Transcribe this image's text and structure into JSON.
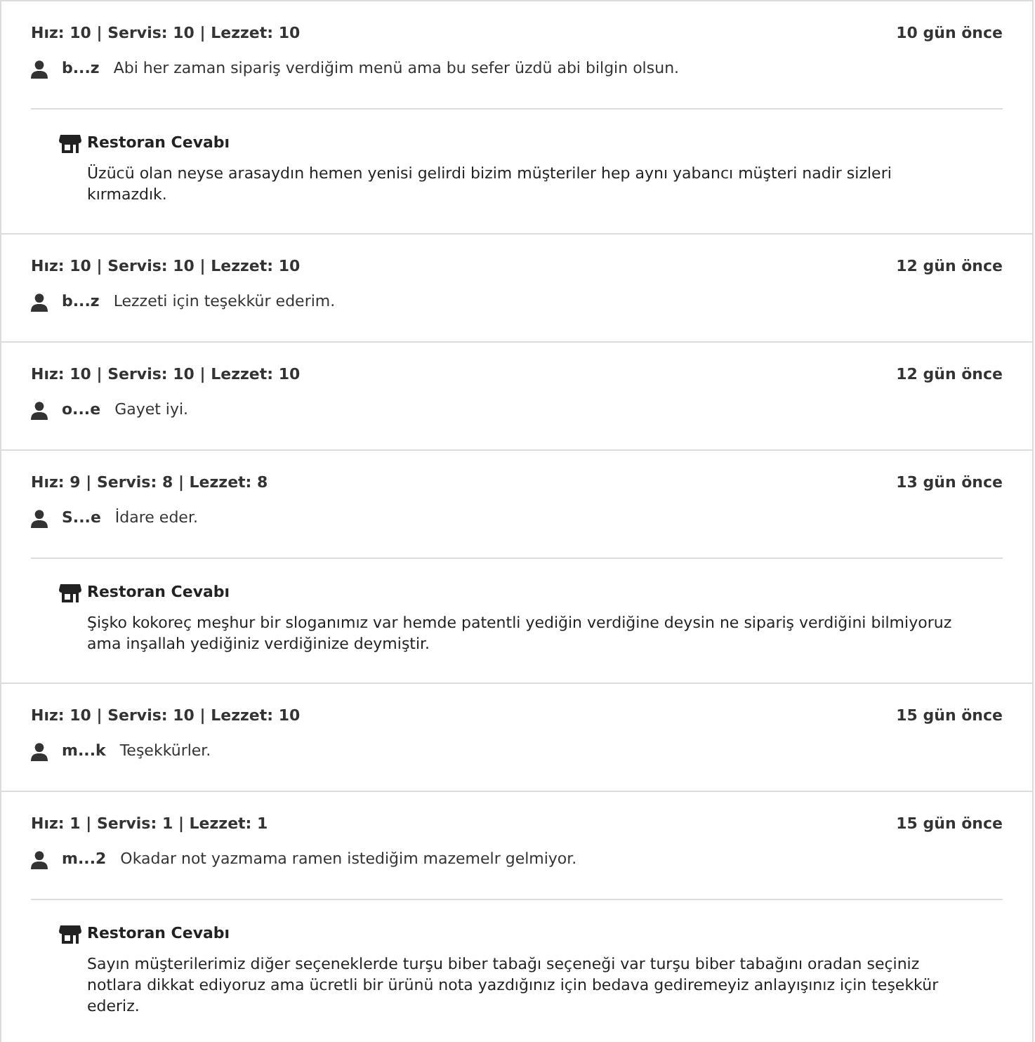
{
  "reviews": [
    {
      "ratings": "Hız: 10 | Servis: 10 | Lezzet: 10",
      "time": "10 gün önce",
      "user": "b...z",
      "comment": "Abi her zaman sipariş verdiğim menü ama bu sefer üzdü abi bilgin olsun.",
      "reply": {
        "title": "Restoran Cevabı",
        "text": "Üzücü olan neyse arasaydın hemen yenisi gelirdi bizim müşteriler hep aynı yabancı müşteri nadir sizleri kırmazdık."
      }
    },
    {
      "ratings": "Hız: 10 | Servis: 10 | Lezzet: 10",
      "time": "12 gün önce",
      "user": "b...z",
      "comment": "Lezzeti için teşekkür ederim."
    },
    {
      "ratings": "Hız: 10 | Servis: 10 | Lezzet: 10",
      "time": "12 gün önce",
      "user": "o...e",
      "comment": "Gayet iyi."
    },
    {
      "ratings": "Hız: 9 | Servis: 8 | Lezzet: 8",
      "time": "13 gün önce",
      "user": "S...e",
      "comment": "İdare eder.",
      "reply": {
        "title": "Restoran Cevabı",
        "text": "Şişko kokoreç meşhur bir sloganımız var hemde patentli yediğin verdiğine deysin ne sipariş verdiğini bilmiyoruz ama inşallah yediğiniz verdiğinize deymiştir."
      }
    },
    {
      "ratings": "Hız: 10 | Servis: 10 | Lezzet: 10",
      "time": "15 gün önce",
      "user": "m...k",
      "comment": "Teşekkürler."
    },
    {
      "ratings": "Hız: 1 | Servis: 1 | Lezzet: 1",
      "time": "15 gün önce",
      "user": "m...2",
      "comment": "Okadar not yazmama ramen istediğim mazemelr gelmiyor.",
      "reply": {
        "title": "Restoran Cevabı",
        "text": "Sayın müşterilerimiz diğer seçeneklerde turşu biber tabağı seçeneği var turşu biber tabağını oradan seçiniz notlara dikkat ediyoruz ama ücretli bir ürünü nota yazdığınız için bedava gediremeyiz anlayışınız için teşekkür ederiz."
      }
    }
  ]
}
